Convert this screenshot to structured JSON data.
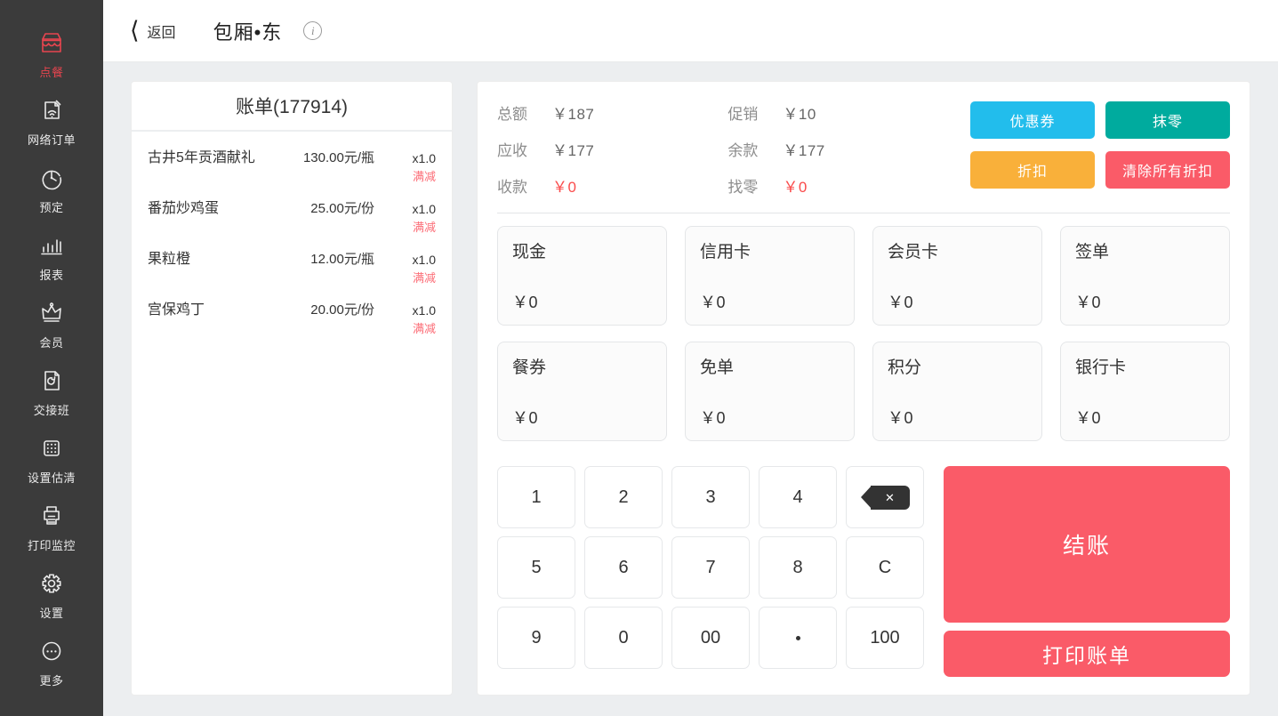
{
  "sidebar": {
    "items": [
      {
        "label": "点餐",
        "icon": "storefront-icon",
        "active": true
      },
      {
        "label": "网络订单",
        "icon": "wifi-order-icon",
        "active": false
      },
      {
        "label": "预定",
        "icon": "clock-icon",
        "active": false
      },
      {
        "label": "报表",
        "icon": "bar-chart-icon",
        "active": false
      },
      {
        "label": "会员",
        "icon": "crown-icon",
        "active": false
      },
      {
        "label": "交接班",
        "icon": "shift-file-icon",
        "active": false
      },
      {
        "label": "设置估清",
        "icon": "grid-dots-icon",
        "active": false
      },
      {
        "label": "打印监控",
        "icon": "printer-icon",
        "active": false
      },
      {
        "label": "设置",
        "icon": "gear-icon",
        "active": false
      },
      {
        "label": "更多",
        "icon": "more-dots-icon",
        "active": false
      }
    ]
  },
  "header": {
    "back_label": "返回",
    "back_icon": "chevron-left-icon",
    "title": "包厢•东",
    "info_icon": "info-icon",
    "info_glyph": "i"
  },
  "bill": {
    "title": "账单(177914)",
    "items": [
      {
        "name": "古井5年贡酒献礼",
        "price": "130.00元/瓶",
        "qty": "x1.0",
        "tag": "满减"
      },
      {
        "name": "番茄炒鸡蛋",
        "price": "25.00元/份",
        "qty": "x1.0",
        "tag": "满减"
      },
      {
        "name": "果粒橙",
        "price": "12.00元/瓶",
        "qty": "x1.0",
        "tag": "满减"
      },
      {
        "name": "宫保鸡丁",
        "price": "20.00元/份",
        "qty": "x1.0",
        "tag": "满减"
      }
    ]
  },
  "summary": {
    "cells": [
      {
        "key": "总额",
        "value": "￥187",
        "red": false
      },
      {
        "key": "促销",
        "value": "￥10",
        "red": false
      },
      {
        "key": "应收",
        "value": "￥177",
        "red": false
      },
      {
        "key": "余款",
        "value": "￥177",
        "red": false
      },
      {
        "key": "收款",
        "value": "￥0",
        "red": true
      },
      {
        "key": "找零",
        "value": "￥0",
        "red": true
      }
    ]
  },
  "actions": [
    {
      "label": "优惠券",
      "color": "#22bdec"
    },
    {
      "label": "抹零",
      "color": "#00ab9e"
    },
    {
      "label": "折扣",
      "color": "#f9b03a"
    },
    {
      "label": "清除所有折扣",
      "color": "#fa5b68"
    }
  ],
  "payments": [
    {
      "name": "现金",
      "amount": "￥0"
    },
    {
      "name": "信用卡",
      "amount": "￥0"
    },
    {
      "name": "会员卡",
      "amount": "￥0"
    },
    {
      "name": "签单",
      "amount": "￥0"
    },
    {
      "name": "餐券",
      "amount": "￥0"
    },
    {
      "name": "免单",
      "amount": "￥0"
    },
    {
      "name": "积分",
      "amount": "￥0"
    },
    {
      "name": "银行卡",
      "amount": "￥0"
    }
  ],
  "keypad": {
    "keys": [
      {
        "label": "1",
        "type": "digit"
      },
      {
        "label": "2",
        "type": "digit"
      },
      {
        "label": "3",
        "type": "digit"
      },
      {
        "label": "4",
        "type": "digit"
      },
      {
        "label": "",
        "type": "backspace",
        "icon": "backspace-icon"
      },
      {
        "label": "5",
        "type": "digit"
      },
      {
        "label": "6",
        "type": "digit"
      },
      {
        "label": "7",
        "type": "digit"
      },
      {
        "label": "8",
        "type": "digit"
      },
      {
        "label": "C",
        "type": "clear"
      },
      {
        "label": "9",
        "type": "digit"
      },
      {
        "label": "0",
        "type": "digit"
      },
      {
        "label": "00",
        "type": "digit"
      },
      {
        "label": "",
        "type": "dot"
      },
      {
        "label": "100",
        "type": "digit"
      }
    ]
  },
  "checkout": {
    "settle_label": "结账",
    "print_label": "打印账单",
    "color": "#fa5b68"
  },
  "theme": {
    "sidebar_bg": "#3b3b3b",
    "accent_red": "#e8454f",
    "page_bg": "#eceef0",
    "tag_red": "#fc6d77",
    "value_red": "#fa4b4b"
  }
}
